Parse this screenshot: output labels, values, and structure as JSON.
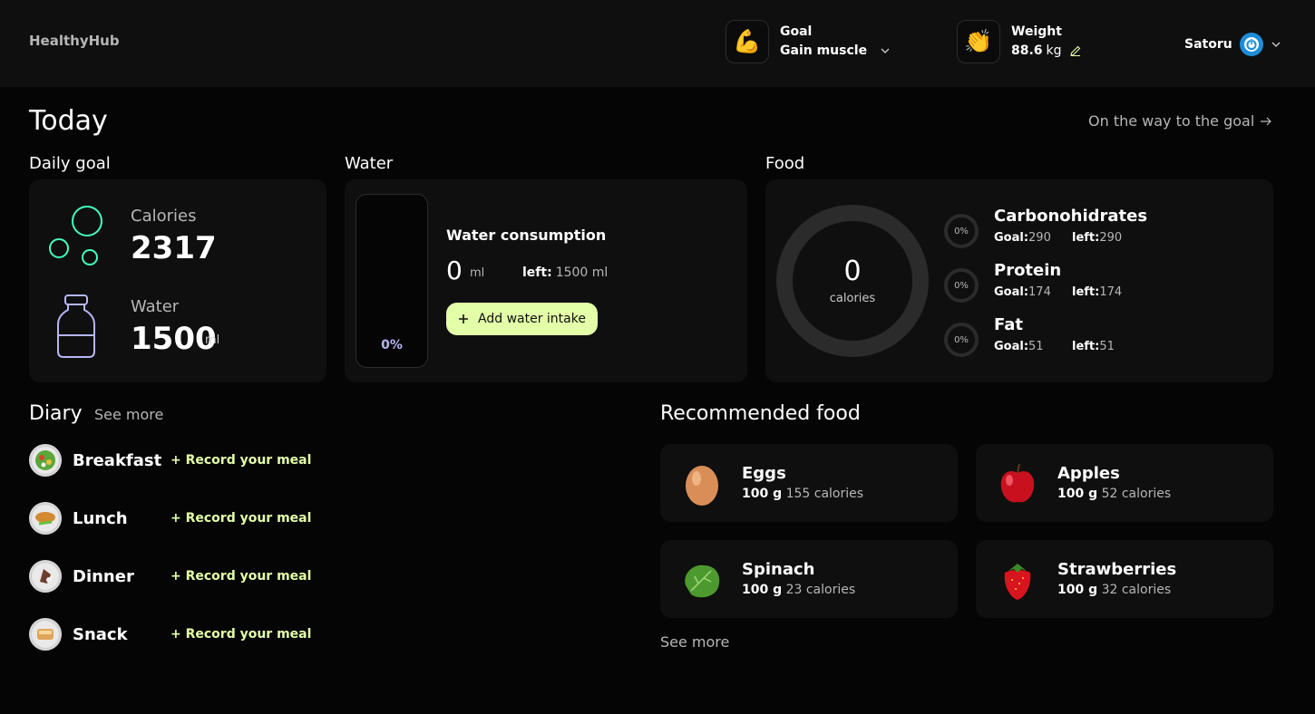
{
  "header": {
    "logo": "HealthyHub",
    "goal": {
      "label": "Goal",
      "value": "Gain muscle"
    },
    "weight": {
      "label": "Weight",
      "value": "88.6",
      "unit": "kg"
    },
    "user": {
      "name": "Satoru"
    }
  },
  "main": {
    "title": "Today",
    "goal_link": "On the way to the goal",
    "daily_goal": {
      "section": "Daily goal",
      "calories_label": "Calories",
      "calories_value": "2317",
      "water_label": "Water",
      "water_value": "1500",
      "water_unit": "ml"
    },
    "water": {
      "section": "Water",
      "percent": "0%",
      "heading": "Water consumption",
      "consumed": "0",
      "unit": "ml",
      "left_label": "left:",
      "left_value": "1500 ml",
      "add_button": "Add water intake"
    },
    "food": {
      "section": "Food",
      "calories_value": "0",
      "calories_label": "calories",
      "goal_label": "Goal:",
      "left_label": "left:",
      "macros": [
        {
          "name": "Carbonohidrates",
          "percent": "0%",
          "goal": "290",
          "left": "290"
        },
        {
          "name": "Protein",
          "percent": "0%",
          "goal": "174",
          "left": "174"
        },
        {
          "name": "Fat",
          "percent": "0%",
          "goal": "51",
          "left": "51"
        }
      ]
    },
    "diary": {
      "title": "Diary",
      "see_more": "See more",
      "record_label": "+ Record your meal",
      "meals": [
        {
          "name": "Breakfast"
        },
        {
          "name": "Lunch"
        },
        {
          "name": "Dinner"
        },
        {
          "name": "Snack"
        }
      ]
    },
    "recommended": {
      "title": "Recommended food",
      "see_more": "See more",
      "items": [
        {
          "name": "Eggs",
          "amount": "100 g",
          "calories": "155 calories"
        },
        {
          "name": "Apples",
          "amount": "100 g",
          "calories": "52 calories"
        },
        {
          "name": "Spinach",
          "amount": "100 g",
          "calories": "23 calories"
        },
        {
          "name": "Strawberries",
          "amount": "100 g",
          "calories": "32 calories"
        }
      ]
    }
  },
  "colors": {
    "accent": "#e3ffa8",
    "bubbles": "#45ffbc",
    "bottle": "#b6b6f5",
    "card": "#0f0f0f",
    "background": "#050505"
  }
}
